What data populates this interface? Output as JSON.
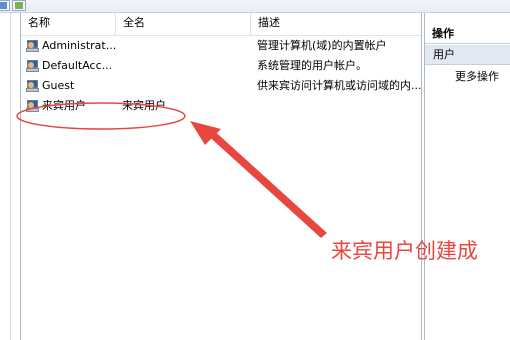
{
  "columns": {
    "name": "名称",
    "full_name": "全名",
    "description": "描述"
  },
  "users": [
    {
      "name": "Administrat...",
      "full_name": "",
      "description": "管理计算机(域)的内置帐户"
    },
    {
      "name": "DefaultAcc...",
      "full_name": "",
      "description": "系统管理的用户帐户。"
    },
    {
      "name": "Guest",
      "full_name": "",
      "description": "供来宾访问计算机或访问域的内..."
    },
    {
      "name": "来宾用户",
      "full_name": "来宾用户",
      "description": ""
    }
  ],
  "actions": {
    "header": "操作",
    "section": "用户",
    "more": "更多操作"
  },
  "annotation": {
    "text": "来宾用户创建成",
    "color": "#e8473f"
  },
  "icons": {
    "user": "user-account-icon"
  }
}
